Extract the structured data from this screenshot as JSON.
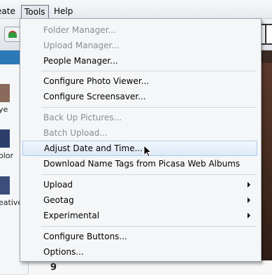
{
  "menubar": {
    "create_label": "eate",
    "tools_label": "Tools",
    "help_label": "Help"
  },
  "sidebar": {
    "labels": [
      "ye",
      "olor",
      "eative"
    ]
  },
  "photo": {
    "corner_number": "9"
  },
  "tools_menu": {
    "items": [
      {
        "label": "Folder Manager...",
        "enabled": false
      },
      {
        "label": "Upload Manager...",
        "enabled": false
      },
      {
        "label": "People Manager...",
        "enabled": true
      },
      {
        "label": "Configure Photo Viewer...",
        "enabled": true
      },
      {
        "label": "Configure Screensaver...",
        "enabled": true
      },
      {
        "label": "Back Up Pictures...",
        "enabled": false
      },
      {
        "label": "Batch Upload...",
        "enabled": false
      },
      {
        "label": "Adjust Date and Time...",
        "enabled": true,
        "highlighted": true
      },
      {
        "label": "Download Name Tags from Picasa Web Albums",
        "enabled": true
      },
      {
        "label": "Upload",
        "enabled": true,
        "submenu": true
      },
      {
        "label": "Geotag",
        "enabled": true,
        "submenu": true
      },
      {
        "label": "Experimental",
        "enabled": true,
        "submenu": true
      },
      {
        "label": "Configure Buttons...",
        "enabled": true
      },
      {
        "label": "Options...",
        "enabled": true
      }
    ]
  },
  "colors": {
    "highlight_fill": "#dde9f7",
    "highlight_border": "#aecbeb",
    "disabled_text": "#8a8d91"
  }
}
